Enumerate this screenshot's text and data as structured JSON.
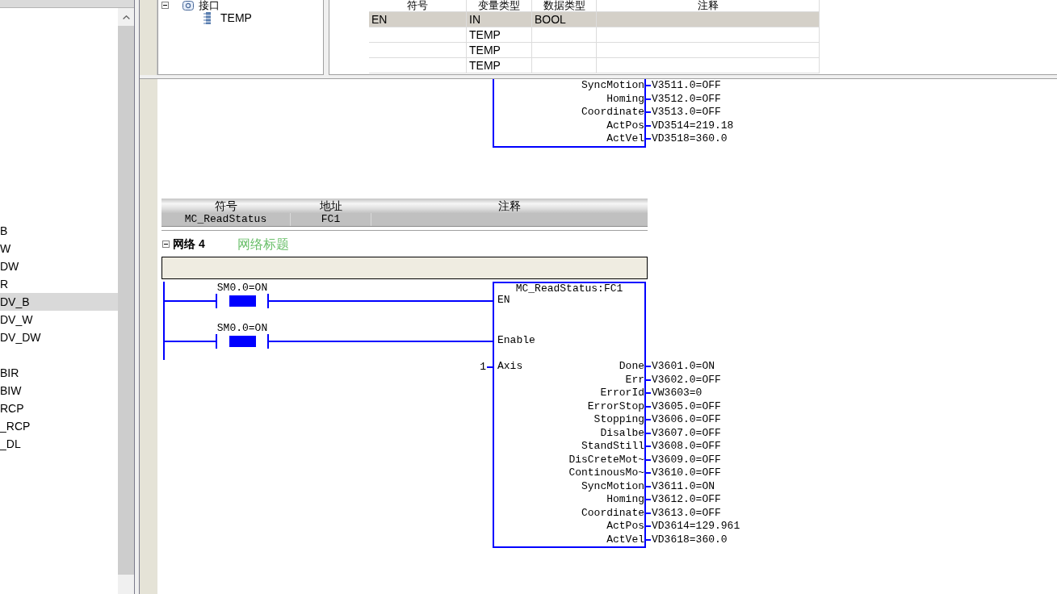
{
  "explorer": {
    "groups": [
      {
        "items": [
          {
            "label": "B",
            "selected": false
          },
          {
            "label": "W",
            "selected": false
          },
          {
            "label": "DW",
            "selected": false
          },
          {
            "label": "R",
            "selected": false
          },
          {
            "label": "DV_B",
            "selected": true
          },
          {
            "label": "DV_W",
            "selected": false
          },
          {
            "label": "DV_DW",
            "selected": false
          }
        ]
      },
      {
        "items": [
          {
            "label": "BIR",
            "selected": false
          },
          {
            "label": "BIW",
            "selected": false
          },
          {
            "label": "RCP",
            "selected": false
          },
          {
            "label": "_RCP",
            "selected": false
          },
          {
            "label": "_DL",
            "selected": false
          }
        ]
      }
    ]
  },
  "tree": {
    "items": [
      {
        "label": "接口",
        "expanded": true,
        "children": [
          {
            "label": "TEMP"
          }
        ]
      }
    ]
  },
  "variables": {
    "columns": [
      "符号",
      "变量类型",
      "数据类型",
      "注释"
    ],
    "rows": [
      {
        "symbol": "EN",
        "var_type": "IN",
        "data_type": "BOOL",
        "selected": true
      },
      {
        "var_type": "TEMP",
        "selected": false
      },
      {
        "var_type": "TEMP",
        "selected": false
      },
      {
        "var_type": "TEMP",
        "selected": false
      }
    ]
  },
  "editor": {
    "previous_block": {
      "outputs": [
        {
          "pin": "SyncMotion",
          "value": "V3511.0=OFF"
        },
        {
          "pin": "Homing",
          "value": "V3512.0=OFF"
        },
        {
          "pin": "Coordinate",
          "value": "V3513.0=OFF"
        },
        {
          "pin": "ActPos",
          "value": "VD3514=219.18"
        },
        {
          "pin": "ActVel",
          "value": "VD3518=360.0"
        }
      ]
    },
    "symbol_table": {
      "columns": [
        "符号",
        "地址",
        "注释"
      ],
      "rows": [
        {
          "symbol": "MC_ReadStatus",
          "address": "FC1"
        }
      ]
    },
    "network": {
      "expanded": true,
      "label": "网络 4",
      "title": "网络标题",
      "rungs": [
        {
          "contact": "SM0.0=ON",
          "on": true
        },
        {
          "contact": "SM0.0=ON",
          "on": true
        }
      ],
      "block": {
        "title": "MC_ReadStatus:FC1",
        "inputs": [
          {
            "pin": "EN"
          },
          {
            "pin": "Enable"
          },
          {
            "pin": "Axis",
            "value": "1"
          }
        ],
        "outputs": [
          {
            "pin": "Done",
            "value": "V3601.0=ON"
          },
          {
            "pin": "Err",
            "value": "V3602.0=OFF"
          },
          {
            "pin": "ErrorId",
            "value": "VW3603=0"
          },
          {
            "pin": "ErrorStop",
            "value": "V3605.0=OFF"
          },
          {
            "pin": "Stopping",
            "value": "V3606.0=OFF"
          },
          {
            "pin": "Disalbe",
            "value": "V3607.0=OFF"
          },
          {
            "pin": "StandStill",
            "value": "V3608.0=OFF"
          },
          {
            "pin": "DisCreteMot~",
            "value": "V3609.0=OFF"
          },
          {
            "pin": "ContinousMo~",
            "value": "V3610.0=OFF"
          },
          {
            "pin": "SyncMotion",
            "value": "V3611.0=ON"
          },
          {
            "pin": "Homing",
            "value": "V3612.0=OFF"
          },
          {
            "pin": "Coordinate",
            "value": "V3613.0=OFF"
          },
          {
            "pin": "ActPos",
            "value": "VD3614=129.961"
          },
          {
            "pin": "ActVel",
            "value": "VD3618=360.0"
          }
        ]
      }
    }
  }
}
